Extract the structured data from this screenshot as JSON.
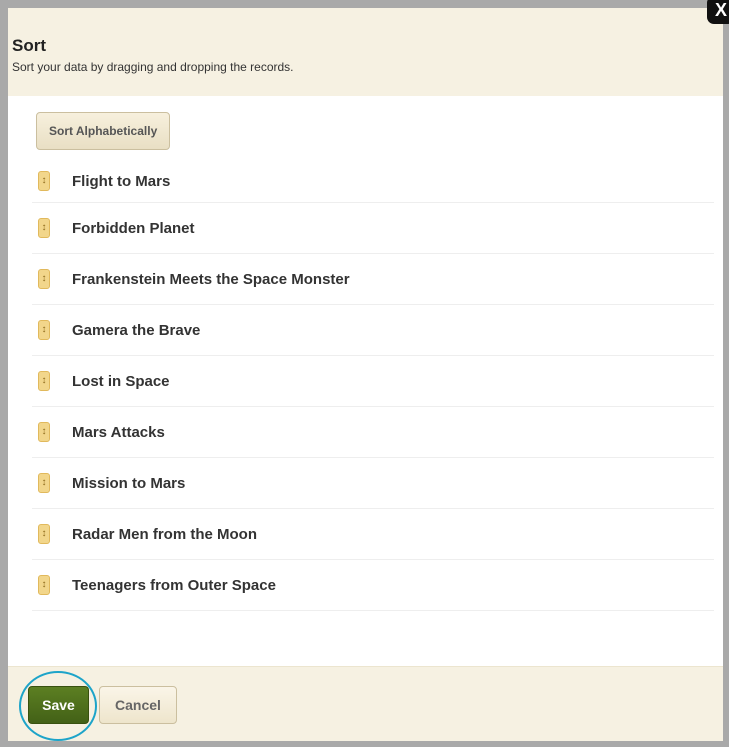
{
  "dialog": {
    "title": "Sort",
    "subtitle": "Sort your data by dragging and dropping the records.",
    "close_label": "X"
  },
  "toolbar": {
    "sort_alpha_label": "Sort Alphabetically"
  },
  "records": [
    "Flight to Mars",
    "Forbidden Planet",
    "Frankenstein Meets the Space Monster",
    "Gamera the Brave",
    "Lost in Space",
    "Mars Attacks",
    "Mission to Mars",
    "Radar Men from the Moon",
    "Teenagers from Outer Space"
  ],
  "footer": {
    "save_label": "Save",
    "cancel_label": "Cancel"
  },
  "colors": {
    "header_bg": "#f6f1e2",
    "save_green": "#4f6f1c",
    "highlight_ring": "#1da4c9",
    "handle": "#f2d68b"
  }
}
